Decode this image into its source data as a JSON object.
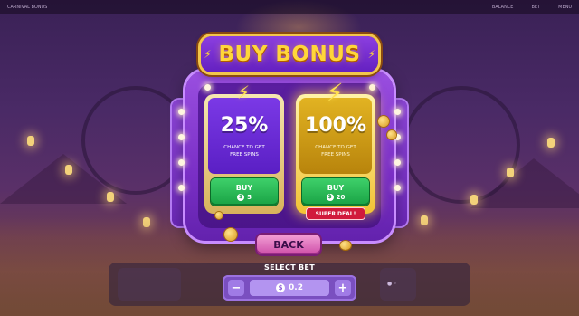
{
  "topbar": {
    "game_label": "CARNIVAL BONUS",
    "right_items": [
      "BALANCE",
      "BET",
      "MENU"
    ]
  },
  "dialog": {
    "title": "BUY BONUS",
    "options": [
      {
        "percent": "25%",
        "description": "CHANCE TO GET FREE SPINS",
        "button_label": "BUY",
        "price": "5",
        "badge": ""
      },
      {
        "percent": "100%",
        "description": "CHANCE TO GET FREE SPINS",
        "button_label": "BUY",
        "price": "20",
        "badge": "SUPER DEAL!"
      }
    ],
    "back_label": "BACK"
  },
  "bet": {
    "label": "SELECT BET",
    "value": "0.2",
    "minus": "−",
    "plus": "+",
    "currency_symbol": "$"
  },
  "icons": {
    "bolt": "lightning-bolt",
    "coin": "dollar-coin"
  },
  "colors": {
    "title": "#ffd63a",
    "buy_button": "#19a244",
    "super_deal": "#d11a3c",
    "panel": "#7a2fc6"
  }
}
